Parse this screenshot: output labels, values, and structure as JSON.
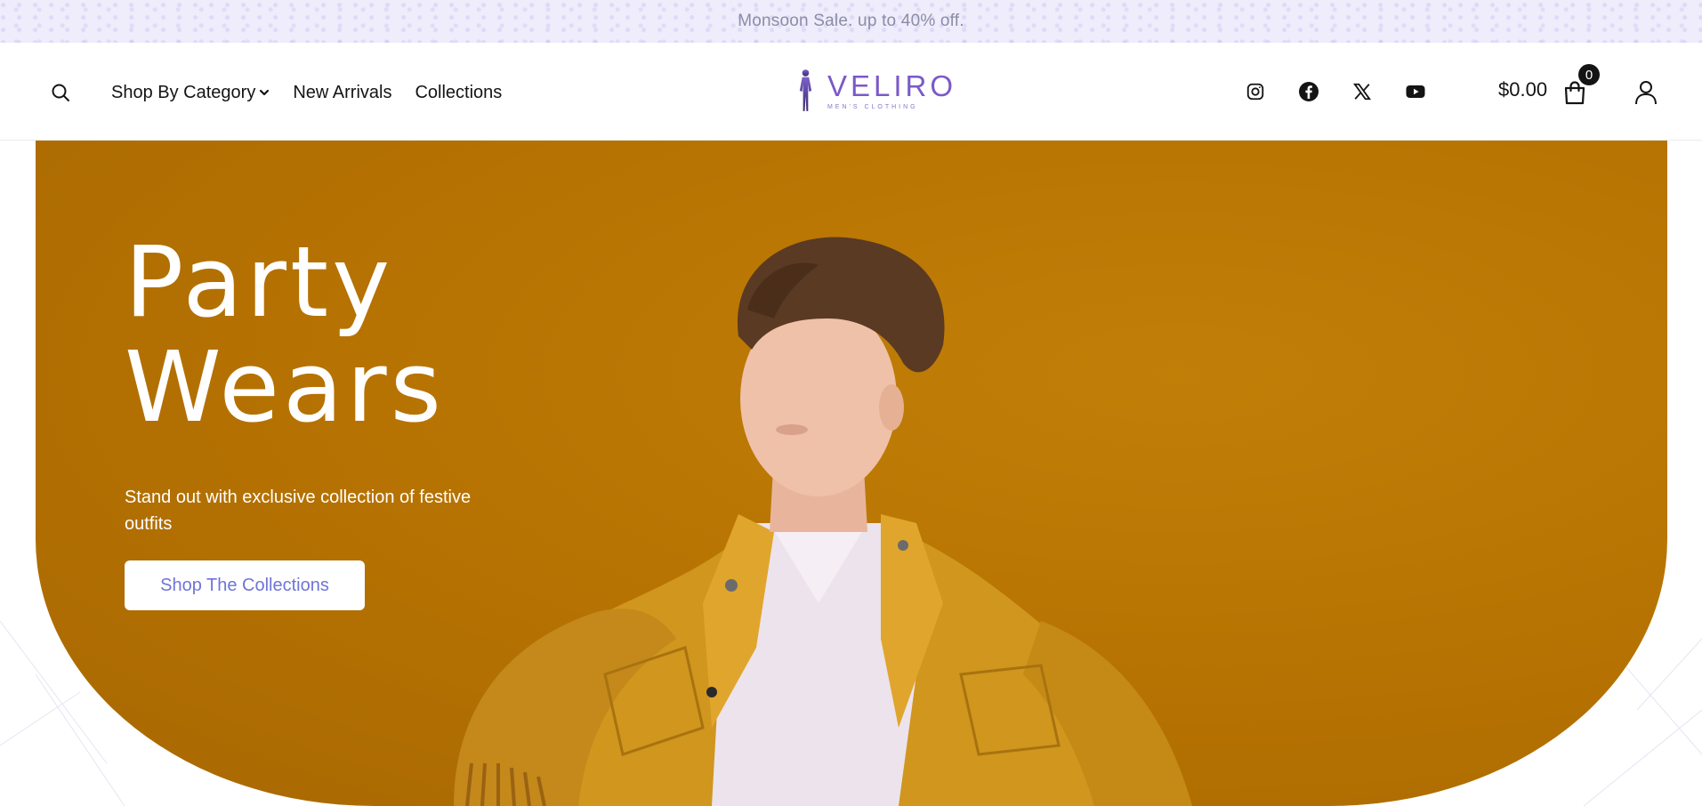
{
  "announcement": {
    "text": "Monsoon Sale. up to 40% off."
  },
  "header": {
    "nav": [
      {
        "label": "Shop By Category",
        "has_dropdown": true
      },
      {
        "label": "New Arrivals"
      },
      {
        "label": "Collections"
      }
    ],
    "logo": {
      "name": "VELIRO",
      "tagline": "MEN'S CLOTHING"
    },
    "social_icons": [
      "instagram-icon",
      "facebook-icon",
      "x-icon",
      "youtube-icon"
    ],
    "cart": {
      "amount": "$0.00",
      "count": "0"
    },
    "icons": {
      "search": "search-icon",
      "cart": "shopping-bag-icon",
      "account": "user-icon",
      "dropdown": "chevron-down-icon"
    }
  },
  "hero": {
    "title_line1": "Party",
    "title_line2": "Wears",
    "subtitle": "Stand out with exclusive collection of festive outfits",
    "button_label": "Shop The Collections",
    "image": "young-man-in-mustard-suede-jacket"
  },
  "colors": {
    "announcement_bg": "#efedfb",
    "hero_bg": "#b87402",
    "brand": "#7a5ac8",
    "button_text": "#6f74d8"
  }
}
